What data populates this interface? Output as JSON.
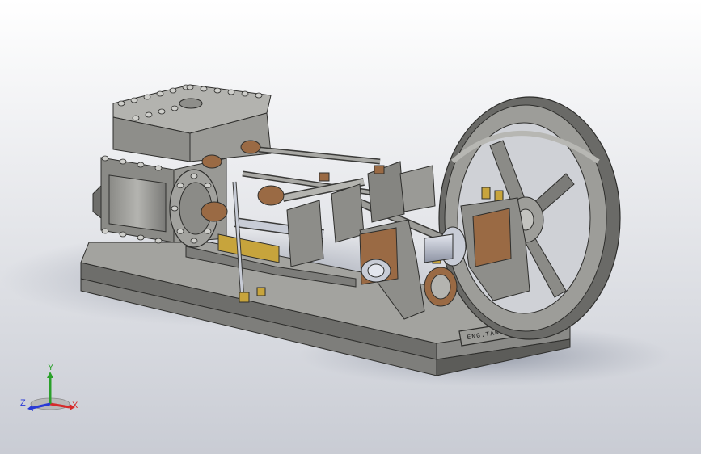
{
  "viewport": {
    "bg_top": "#ffffff",
    "bg_bottom": "#c9ccd4",
    "model_color": "#8e8e8a",
    "model_dark": "#5f5f5c",
    "model_light": "#b9b9b5",
    "brass_color": "#c7a43c",
    "copper_color": "#9a6a44",
    "steel_color": "#c8ccd6"
  },
  "nameplate": {
    "text": "ENG.TANYA"
  },
  "triad": {
    "x_label": "X",
    "y_label": "Y",
    "z_label": "Z",
    "x_color": "#d62a2a",
    "y_color": "#2aa02a",
    "z_color": "#2a3ad6"
  }
}
